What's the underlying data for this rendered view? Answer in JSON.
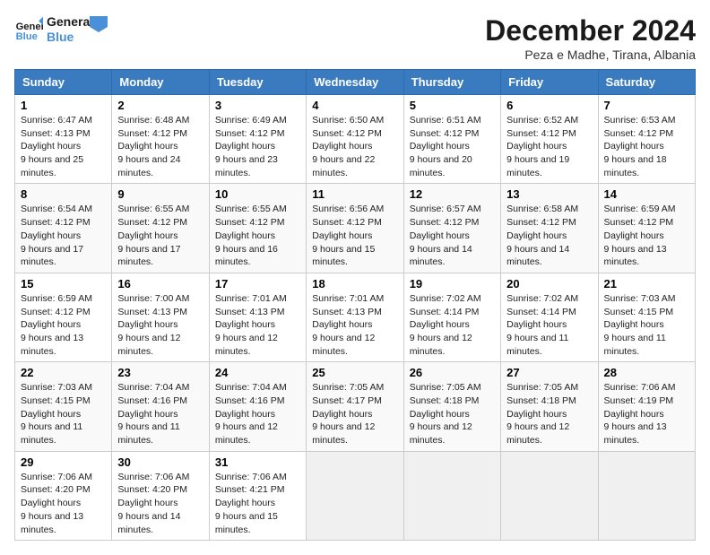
{
  "header": {
    "logo_general": "General",
    "logo_blue": "Blue",
    "month_title": "December 2024",
    "location": "Peza e Madhe, Tirana, Albania"
  },
  "days_of_week": [
    "Sunday",
    "Monday",
    "Tuesday",
    "Wednesday",
    "Thursday",
    "Friday",
    "Saturday"
  ],
  "weeks": [
    [
      {
        "num": "1",
        "sunrise": "6:47 AM",
        "sunset": "4:13 PM",
        "daylight": "9 hours and 25 minutes."
      },
      {
        "num": "2",
        "sunrise": "6:48 AM",
        "sunset": "4:12 PM",
        "daylight": "9 hours and 24 minutes."
      },
      {
        "num": "3",
        "sunrise": "6:49 AM",
        "sunset": "4:12 PM",
        "daylight": "9 hours and 23 minutes."
      },
      {
        "num": "4",
        "sunrise": "6:50 AM",
        "sunset": "4:12 PM",
        "daylight": "9 hours and 22 minutes."
      },
      {
        "num": "5",
        "sunrise": "6:51 AM",
        "sunset": "4:12 PM",
        "daylight": "9 hours and 20 minutes."
      },
      {
        "num": "6",
        "sunrise": "6:52 AM",
        "sunset": "4:12 PM",
        "daylight": "9 hours and 19 minutes."
      },
      {
        "num": "7",
        "sunrise": "6:53 AM",
        "sunset": "4:12 PM",
        "daylight": "9 hours and 18 minutes."
      }
    ],
    [
      {
        "num": "8",
        "sunrise": "6:54 AM",
        "sunset": "4:12 PM",
        "daylight": "9 hours and 17 minutes."
      },
      {
        "num": "9",
        "sunrise": "6:55 AM",
        "sunset": "4:12 PM",
        "daylight": "9 hours and 17 minutes."
      },
      {
        "num": "10",
        "sunrise": "6:55 AM",
        "sunset": "4:12 PM",
        "daylight": "9 hours and 16 minutes."
      },
      {
        "num": "11",
        "sunrise": "6:56 AM",
        "sunset": "4:12 PM",
        "daylight": "9 hours and 15 minutes."
      },
      {
        "num": "12",
        "sunrise": "6:57 AM",
        "sunset": "4:12 PM",
        "daylight": "9 hours and 14 minutes."
      },
      {
        "num": "13",
        "sunrise": "6:58 AM",
        "sunset": "4:12 PM",
        "daylight": "9 hours and 14 minutes."
      },
      {
        "num": "14",
        "sunrise": "6:59 AM",
        "sunset": "4:12 PM",
        "daylight": "9 hours and 13 minutes."
      }
    ],
    [
      {
        "num": "15",
        "sunrise": "6:59 AM",
        "sunset": "4:12 PM",
        "daylight": "9 hours and 13 minutes."
      },
      {
        "num": "16",
        "sunrise": "7:00 AM",
        "sunset": "4:13 PM",
        "daylight": "9 hours and 12 minutes."
      },
      {
        "num": "17",
        "sunrise": "7:01 AM",
        "sunset": "4:13 PM",
        "daylight": "9 hours and 12 minutes."
      },
      {
        "num": "18",
        "sunrise": "7:01 AM",
        "sunset": "4:13 PM",
        "daylight": "9 hours and 12 minutes."
      },
      {
        "num": "19",
        "sunrise": "7:02 AM",
        "sunset": "4:14 PM",
        "daylight": "9 hours and 12 minutes."
      },
      {
        "num": "20",
        "sunrise": "7:02 AM",
        "sunset": "4:14 PM",
        "daylight": "9 hours and 11 minutes."
      },
      {
        "num": "21",
        "sunrise": "7:03 AM",
        "sunset": "4:15 PM",
        "daylight": "9 hours and 11 minutes."
      }
    ],
    [
      {
        "num": "22",
        "sunrise": "7:03 AM",
        "sunset": "4:15 PM",
        "daylight": "9 hours and 11 minutes."
      },
      {
        "num": "23",
        "sunrise": "7:04 AM",
        "sunset": "4:16 PM",
        "daylight": "9 hours and 11 minutes."
      },
      {
        "num": "24",
        "sunrise": "7:04 AM",
        "sunset": "4:16 PM",
        "daylight": "9 hours and 12 minutes."
      },
      {
        "num": "25",
        "sunrise": "7:05 AM",
        "sunset": "4:17 PM",
        "daylight": "9 hours and 12 minutes."
      },
      {
        "num": "26",
        "sunrise": "7:05 AM",
        "sunset": "4:18 PM",
        "daylight": "9 hours and 12 minutes."
      },
      {
        "num": "27",
        "sunrise": "7:05 AM",
        "sunset": "4:18 PM",
        "daylight": "9 hours and 12 minutes."
      },
      {
        "num": "28",
        "sunrise": "7:06 AM",
        "sunset": "4:19 PM",
        "daylight": "9 hours and 13 minutes."
      }
    ],
    [
      {
        "num": "29",
        "sunrise": "7:06 AM",
        "sunset": "4:20 PM",
        "daylight": "9 hours and 13 minutes."
      },
      {
        "num": "30",
        "sunrise": "7:06 AM",
        "sunset": "4:20 PM",
        "daylight": "9 hours and 14 minutes."
      },
      {
        "num": "31",
        "sunrise": "7:06 AM",
        "sunset": "4:21 PM",
        "daylight": "9 hours and 15 minutes."
      },
      null,
      null,
      null,
      null
    ]
  ],
  "labels": {
    "sunrise": "Sunrise:",
    "sunset": "Sunset:",
    "daylight": "Daylight hours"
  }
}
